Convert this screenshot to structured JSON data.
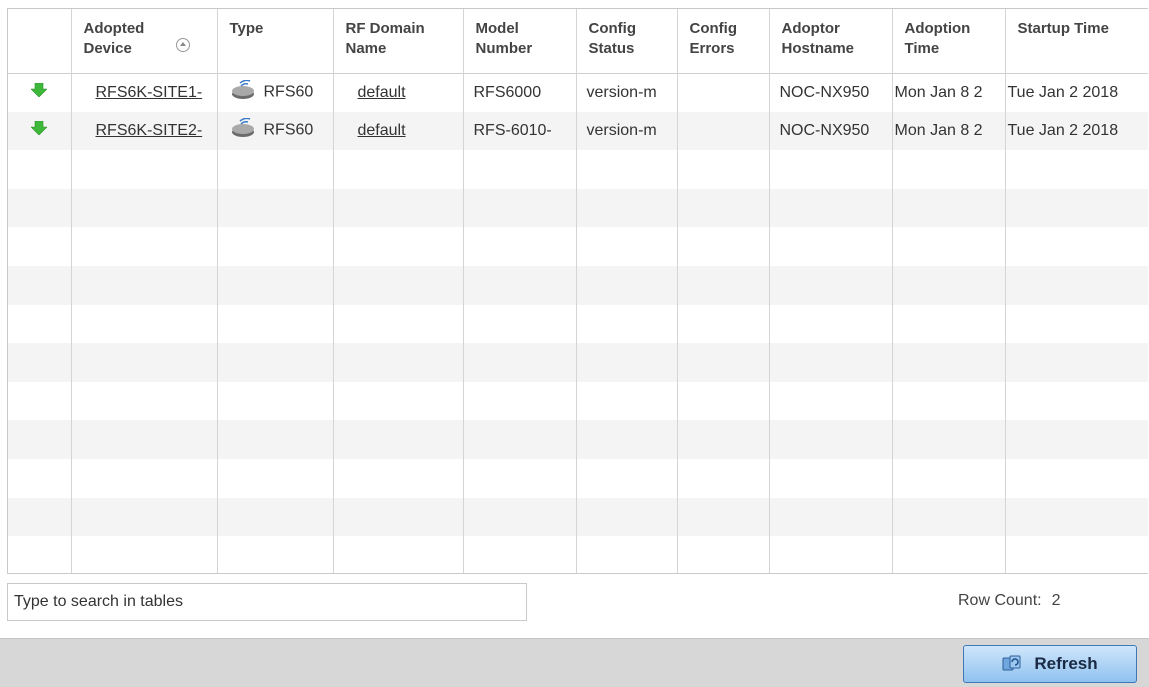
{
  "table": {
    "columns": [
      {
        "key": "status",
        "label": ""
      },
      {
        "key": "adopted_device",
        "label": "Adopted Device"
      },
      {
        "key": "type",
        "label": "Type"
      },
      {
        "key": "rf_domain",
        "label": "RF Domain Name"
      },
      {
        "key": "model",
        "label": "Model Number"
      },
      {
        "key": "config_status",
        "label": "Config Status"
      },
      {
        "key": "config_errors",
        "label": "Config Errors"
      },
      {
        "key": "adoptor_hostname",
        "label": "Adoptor Hostname"
      },
      {
        "key": "adoption_time",
        "label": "Adoption Time"
      },
      {
        "key": "startup_time",
        "label": "Startup Time"
      }
    ],
    "rows": [
      {
        "status_icon": "green-arrow-down-icon",
        "adopted_device": "RFS6K-SITE1-",
        "type": "RFS60",
        "rf_domain": "default",
        "model": "RFS6000",
        "config_status": "version-m",
        "config_errors": "",
        "adoptor_hostname": "NOC-NX950",
        "adoption_time": "Mon Jan 8 2",
        "startup_time": "Tue Jan 2 2018"
      },
      {
        "status_icon": "green-arrow-down-icon",
        "adopted_device": "RFS6K-SITE2-",
        "type": "RFS60",
        "rf_domain": "default",
        "model": "RFS-6010-",
        "config_status": "version-m",
        "config_errors": "",
        "adoptor_hostname": "NOC-NX950",
        "adoption_time": "Mon Jan 8 2",
        "startup_time": "Tue Jan 2 2018"
      }
    ]
  },
  "search": {
    "placeholder": "Type to search in tables"
  },
  "row_count": {
    "label": "Row Count:",
    "value": "2"
  },
  "refresh": {
    "label": "Refresh"
  },
  "colors": {
    "accent": "#3f78b8",
    "status_ok": "#3db83a",
    "footer": "#d7d7d7"
  }
}
